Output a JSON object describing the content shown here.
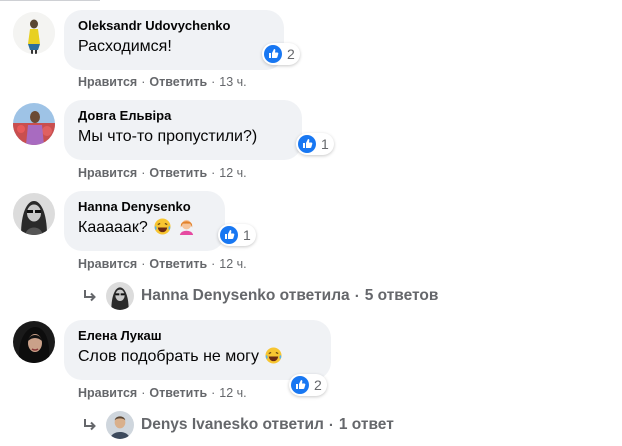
{
  "ui": {
    "like_label": "Нравится",
    "reply_label": "Ответить",
    "dot": "·"
  },
  "comments": [
    {
      "author": "Oleksandr Udovychenko",
      "text": "Расходимся!",
      "reactions": "2",
      "time": "13 ч."
    },
    {
      "author": "Довга Ельвіра",
      "text": "Мы что-то пропустили?)",
      "reactions": "1",
      "time": "12 ч."
    },
    {
      "author": "Hanna Denysenko",
      "text": "Кааааак?",
      "emoji": [
        "laughing-face",
        "woman-facepalming"
      ],
      "reactions": "1",
      "time": "12 ч.",
      "replies": {
        "text": "Hanna Denysenko ответила",
        "count": "5 ответов"
      }
    },
    {
      "author": "Елена Лукаш",
      "text": "Слов подобрать не могу",
      "emoji": [
        "laughing-face"
      ],
      "reactions": "2",
      "time": "12 ч.",
      "replies": {
        "text": "Denys Ivanesko ответил",
        "count": "1 ответ"
      }
    }
  ],
  "colors": {
    "bubble": "#f0f2f5",
    "secondary_text": "#65676b",
    "like_blue": "#1877f2"
  }
}
